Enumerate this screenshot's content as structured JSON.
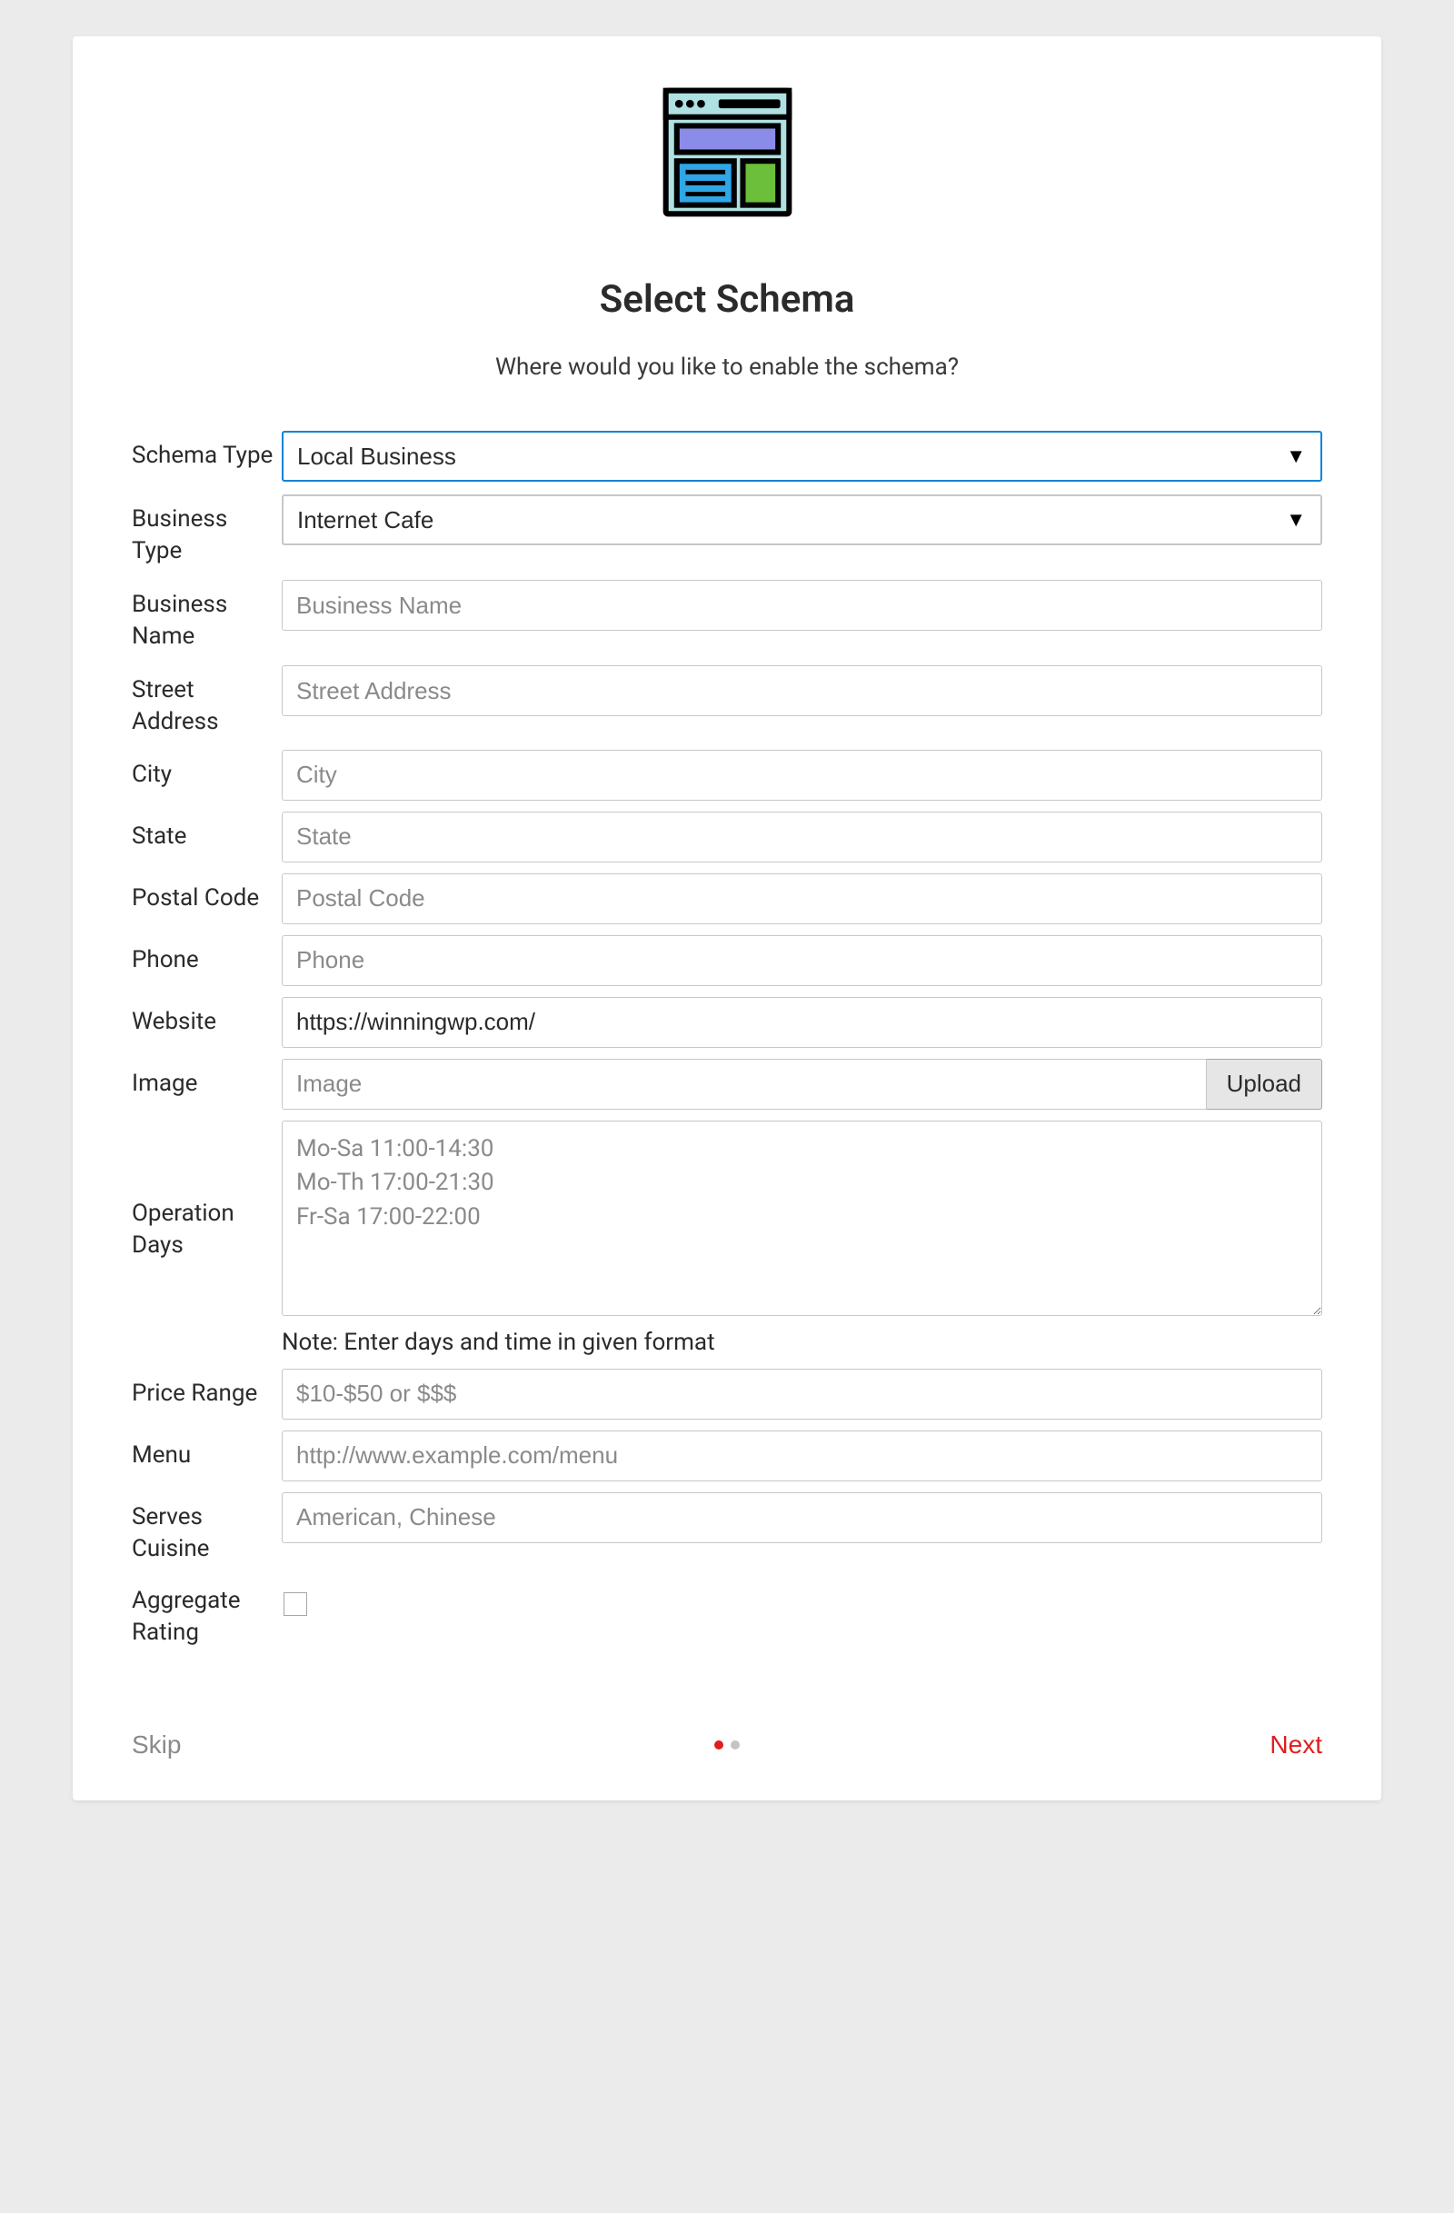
{
  "header": {
    "title": "Select Schema",
    "subtitle": "Where would you like to enable the schema?"
  },
  "fields": {
    "schema_type": {
      "label": "Schema Type",
      "value": "Local Business"
    },
    "business_type": {
      "label": "Business Type",
      "value": "Internet Cafe"
    },
    "business_name": {
      "label": "Business Name",
      "placeholder": "Business Name",
      "value": ""
    },
    "street_address": {
      "label": "Street Address",
      "placeholder": "Street Address",
      "value": ""
    },
    "city": {
      "label": "City",
      "placeholder": "City",
      "value": ""
    },
    "state": {
      "label": "State",
      "placeholder": "State",
      "value": ""
    },
    "postal_code": {
      "label": "Postal Code",
      "placeholder": "Postal Code",
      "value": ""
    },
    "phone": {
      "label": "Phone",
      "placeholder": "Phone",
      "value": ""
    },
    "website": {
      "label": "Website",
      "placeholder": "",
      "value": "https://winningwp.com/"
    },
    "image": {
      "label": "Image",
      "placeholder": "Image",
      "value": "",
      "button": "Upload"
    },
    "operation_days": {
      "label": "Operation Days",
      "placeholder": "Mo-Sa 11:00-14:30\nMo-Th 17:00-21:30\nFr-Sa 17:00-22:00",
      "value": "",
      "note": "Note: Enter days and time in given format"
    },
    "price_range": {
      "label": "Price Range",
      "placeholder": "$10-$50 or $$$",
      "value": ""
    },
    "menu": {
      "label": "Menu",
      "placeholder": "http://www.example.com/menu",
      "value": ""
    },
    "serves_cuisine": {
      "label": "Serves Cuisine",
      "placeholder": "American, Chinese",
      "value": ""
    },
    "aggregate_rating": {
      "label": "Aggregate Rating",
      "checked": false
    }
  },
  "footer": {
    "skip": "Skip",
    "next": "Next"
  },
  "pagination": {
    "current": 0,
    "total": 2
  }
}
